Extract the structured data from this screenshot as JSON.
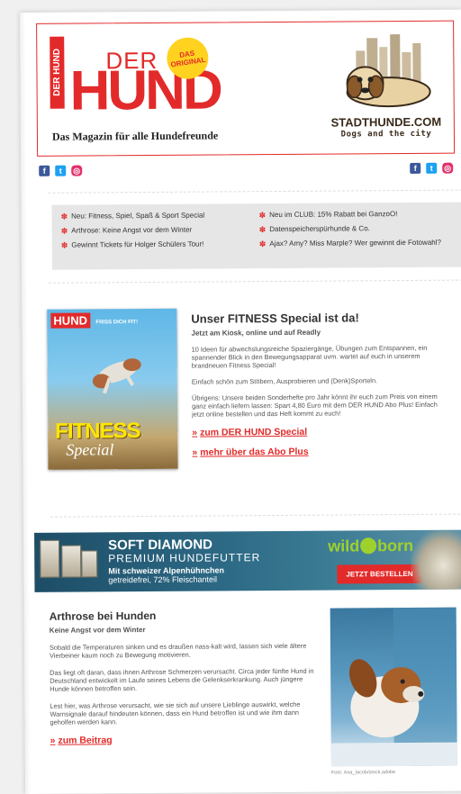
{
  "header": {
    "logo_side": "DER HUND",
    "logo_der": "DER",
    "logo_hund": "HUND",
    "badge_line1": "DAS",
    "badge_line2": "ORIGINAL",
    "tagline": "Das Magazin für alle Hundefreunde",
    "city_brand": "STADTHUNDE.COM",
    "city_tagline": "Dogs and the city"
  },
  "social": {
    "left": [
      "facebook-icon",
      "twitter-icon",
      "instagram-icon"
    ],
    "right": [
      "facebook-icon",
      "twitter-icon",
      "instagram-icon"
    ]
  },
  "news": {
    "items": [
      "Neu: Fitness, Spiel, Spaß & Sport Special",
      "Neu im CLUB: 15% Rabatt bei GanzoO!",
      "Arthrose: Keine Angst vor dem Winter",
      "Datenspeicherspürhunde & Co.",
      "Gewinnt Tickets für Holger Schülers Tour!",
      "Ajax? Amy? Miss Marple? Wer gewinnt die Fotowahl?"
    ]
  },
  "fitness": {
    "cover_logo": "HUND",
    "cover_sub": "FRISS DICH FIT!",
    "cover_title": "FITNESS",
    "cover_special": "Special",
    "title": "Unser FITNESS Special ist da!",
    "subtitle": "Jetzt am Kiosk, online und auf Readly",
    "p1": "10 Ideen für abwechslungsreiche Spaziergänge, Übungen zum Entspannen, ein spannender Blick in den Bewegungsapparat uvm. wartet auf euch in unserem brandneuen Fitness Special!",
    "p2": "Einfach schön zum Stöbern, Ausprobieren und (Denk)Sporteln.",
    "p3": "Übrigens: Unsere beiden Sonderhefte pro Jahr könnt ihr euch zum Preis von einem ganz einfach liefern lassen: Spart 4,80 Euro mit dem DER HUND Abo Plus! Einfach jetzt online bestellen und das Heft kommt zu euch!",
    "link1": "zum DER HUND Special",
    "link2": "mehr über das Abo Plus",
    "arrow": "»"
  },
  "banner": {
    "title": "SOFT DIAMOND",
    "subtitle": "PREMIUM HUNDEFUTTER",
    "line1": "Mit schweizer Alpenhühnchen",
    "line2": "getreidefrei, 72% Fleischanteil",
    "brand_a": "wild",
    "brand_b": "born",
    "cta": "JETZT BESTELLEN"
  },
  "arthrose": {
    "title": "Arthrose bei Hunden",
    "subtitle": "Keine Angst vor dem Winter",
    "p1": "Sobald die Temperaturen sinken und es draußen nass-kalt wird, lassen sich viele ältere Vierbeiner kaum noch zu Bewegung motivieren.",
    "p2": "Das liegt oft daran, dass ihnen Arthrose Schmerzen verursacht. Circa jeder fünfte Hund in Deutschland entwickelt im Laufe seines Lebens die Gelenkserkrankung. Auch jüngere Hunde können betroffen sein.",
    "p3": "Lest hier, was Arthrose verursacht, wie sie sich auf unsere Lieblinge auswirkt, welche Warnsignale darauf hindeuten können, dass ein Hund betroffen ist und wie ihm dann geholfen werden kann.",
    "link": "zum Beitrag",
    "photo_credit": "Foto: Ana_Iacob/stock.adobe"
  },
  "colors": {
    "accent": "#e32a2a",
    "banner": "#2d6a86",
    "banner_green": "#9fd12c"
  }
}
